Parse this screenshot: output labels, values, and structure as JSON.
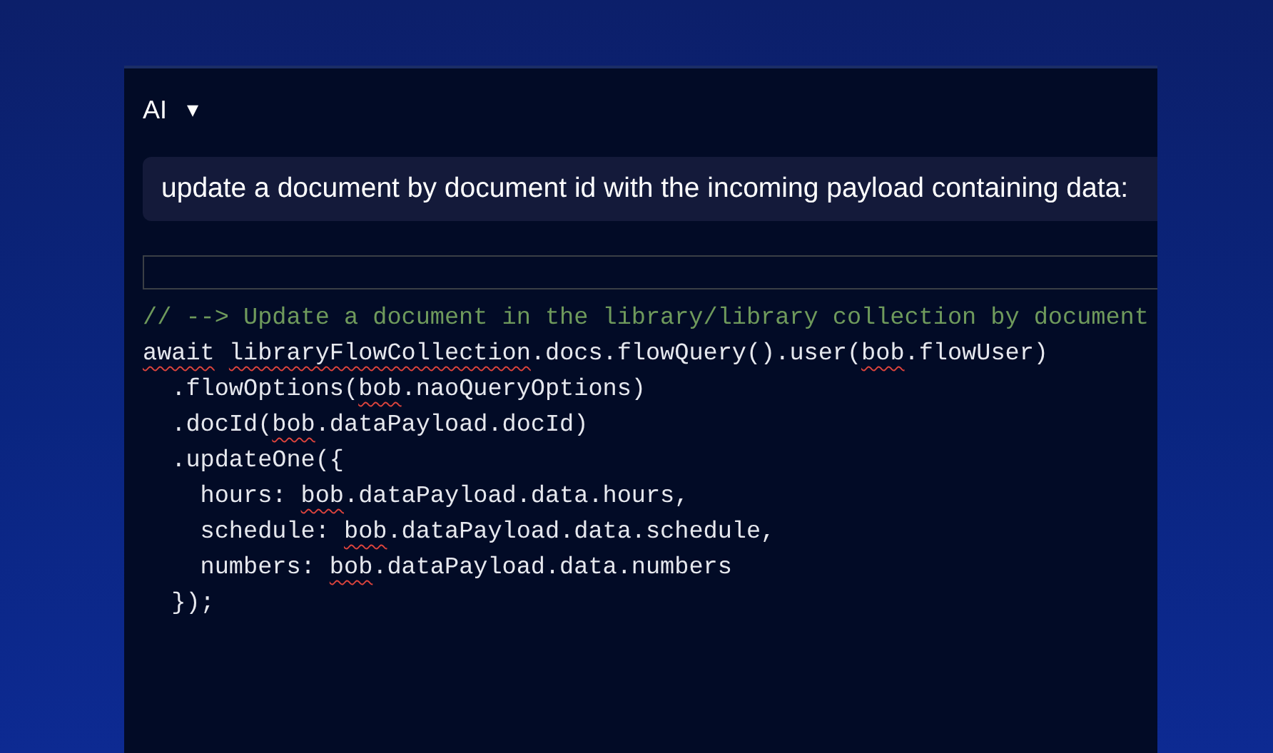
{
  "header": {
    "title": "AI",
    "caret": "▾"
  },
  "prompt": {
    "text": "update a document by document id with the incoming payload containing data:"
  },
  "code": {
    "lines": [
      {
        "kind": "comment",
        "segments": [
          {
            "text": "// --> Update a document in the library/library collection by document",
            "flagged": false
          }
        ]
      },
      {
        "kind": "code",
        "segments": [
          {
            "text": "await",
            "flagged": true
          },
          {
            "text": " libraryFlowCollection",
            "flagged": true
          },
          {
            "text": ".docs.flowQuery().user(",
            "flagged": false
          },
          {
            "text": "bob",
            "flagged": true
          },
          {
            "text": ".flowUser)",
            "flagged": false
          }
        ]
      },
      {
        "kind": "code",
        "segments": [
          {
            "text": "  .flowOptions(",
            "flagged": false
          },
          {
            "text": "bob",
            "flagged": true
          },
          {
            "text": ".naoQueryOptions)",
            "flagged": false
          }
        ]
      },
      {
        "kind": "code",
        "segments": [
          {
            "text": "  .docId(",
            "flagged": false
          },
          {
            "text": "bob",
            "flagged": true
          },
          {
            "text": ".dataPayload.docId)",
            "flagged": false
          }
        ]
      },
      {
        "kind": "code",
        "segments": [
          {
            "text": "  .updateOne({",
            "flagged": false
          }
        ]
      },
      {
        "kind": "code",
        "segments": [
          {
            "text": "    hours: ",
            "flagged": false
          },
          {
            "text": "bob",
            "flagged": true
          },
          {
            "text": ".dataPayload.data.hours,",
            "flagged": false
          }
        ]
      },
      {
        "kind": "code",
        "segments": [
          {
            "text": "    schedule: ",
            "flagged": false
          },
          {
            "text": "bob",
            "flagged": true
          },
          {
            "text": ".dataPayload.data.schedule,",
            "flagged": false
          }
        ]
      },
      {
        "kind": "code",
        "segments": [
          {
            "text": "    numbers: ",
            "flagged": false
          },
          {
            "text": "bob",
            "flagged": true
          },
          {
            "text": ".dataPayload.data.numbers",
            "flagged": false
          }
        ]
      },
      {
        "kind": "code",
        "segments": [
          {
            "text": "  });",
            "flagged": false
          }
        ]
      }
    ]
  }
}
